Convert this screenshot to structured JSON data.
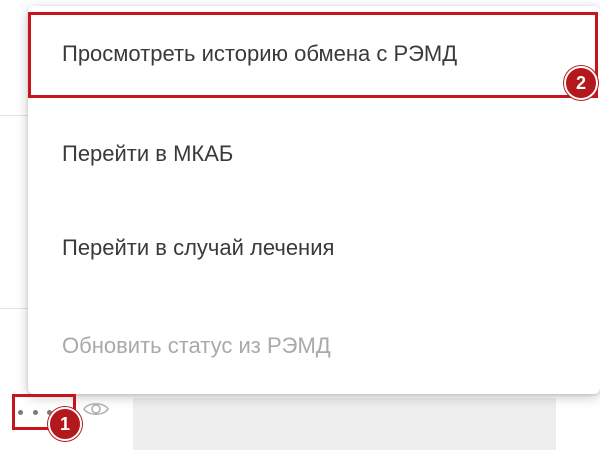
{
  "menu": {
    "items": [
      {
        "label": "Просмотреть историю обмена с РЭМД",
        "enabled": true,
        "highlighted": true
      },
      {
        "label": "Перейти в МКАБ",
        "enabled": true
      },
      {
        "label": "Перейти в случай лечения",
        "enabled": true
      },
      {
        "label": "Обновить статус из РЭМД",
        "enabled": false
      }
    ]
  },
  "annotations": {
    "badge_1": "1",
    "badge_2": "2",
    "highlight_color": "#c8141c"
  },
  "row_actions": {
    "more_icon": "more-dots-icon",
    "view_icon": "eye-icon"
  }
}
